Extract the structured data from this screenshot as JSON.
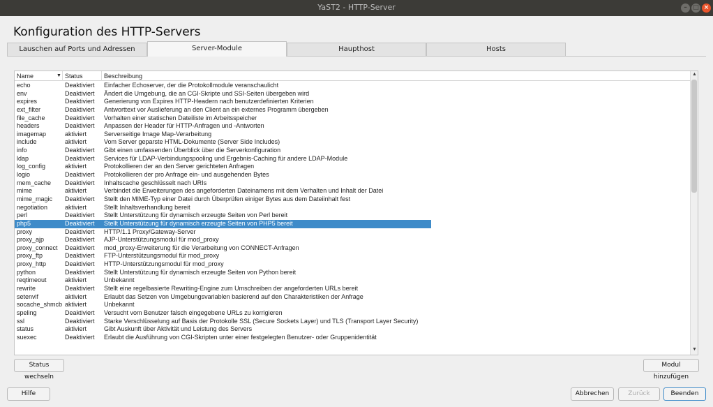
{
  "window": {
    "title": "YaST2 - HTTP-Server"
  },
  "page": {
    "title": "Konfiguration des HTTP-Servers"
  },
  "tabs": [
    {
      "label": "Lauschen auf Ports und Adressen",
      "active": false
    },
    {
      "label": "Server-Module",
      "active": true
    },
    {
      "label": "Haupthost",
      "active": false
    },
    {
      "label": "Hosts",
      "active": false
    }
  ],
  "table": {
    "columns": [
      "Name",
      "Status",
      "Beschreibung"
    ],
    "rows": [
      {
        "name": "echo",
        "status": "Deaktiviert",
        "desc": "Einfacher Echoserver, der die Protokollmodule veranschaulicht"
      },
      {
        "name": "env",
        "status": "Deaktiviert",
        "desc": "Ändert die Umgebung, die an CGI-Skripte und SSI-Seiten übergeben wird"
      },
      {
        "name": "expires",
        "status": "Deaktiviert",
        "desc": "Generierung von Expires HTTP-Headern nach benutzerdefinierten Kriterien"
      },
      {
        "name": "ext_filter",
        "status": "Deaktiviert",
        "desc": "Antworttext vor Auslieferung an den Client an ein externes Programm übergeben"
      },
      {
        "name": "file_cache",
        "status": "Deaktiviert",
        "desc": "Vorhalten einer statischen Dateiliste im Arbeitsspeicher"
      },
      {
        "name": "headers",
        "status": "Deaktiviert",
        "desc": "Anpassen der Header für HTTP-Anfragen und -Antworten"
      },
      {
        "name": "imagemap",
        "status": "aktiviert",
        "desc": "Serverseitige Image Map-Verarbeitung"
      },
      {
        "name": "include",
        "status": "aktiviert",
        "desc": "Vom Server geparste HTML-Dokumente (Server Side Includes)"
      },
      {
        "name": "info",
        "status": "Deaktiviert",
        "desc": "Gibt einen umfassenden Überblick über die Serverkonfiguration"
      },
      {
        "name": "ldap",
        "status": "Deaktiviert",
        "desc": "Services für LDAP-Verbindungspooling und Ergebnis-Caching für andere LDAP-Module"
      },
      {
        "name": "log_config",
        "status": "aktiviert",
        "desc": "Protokollieren der an den Server gerichteten Anfragen"
      },
      {
        "name": "logio",
        "status": "Deaktiviert",
        "desc": "Protokollieren der pro Anfrage ein- und ausgehenden Bytes"
      },
      {
        "name": "mem_cache",
        "status": "Deaktiviert",
        "desc": "Inhaltscache geschlüsselt nach URIs"
      },
      {
        "name": "mime",
        "status": "aktiviert",
        "desc": "Verbindet die Erweiterungen des angeforderten Dateinamens mit dem Verhalten und Inhalt der Datei"
      },
      {
        "name": "mime_magic",
        "status": "Deaktiviert",
        "desc": "Stellt den MIME-Typ einer Datei durch Überprüfen einiger Bytes aus dem Dateiinhalt fest"
      },
      {
        "name": "negotiation",
        "status": "aktiviert",
        "desc": "Stellt Inhaltsverhandlung bereit"
      },
      {
        "name": "perl",
        "status": "Deaktiviert",
        "desc": "Stellt Unterstützung für dynamisch erzeugte Seiten von Perl bereit"
      },
      {
        "name": "php5",
        "status": "Deaktiviert",
        "desc": "Stellt Unterstützung für dynamisch erzeugte Seiten von PHP5 bereit",
        "selected": true
      },
      {
        "name": "proxy",
        "status": "Deaktiviert",
        "desc": "HTTP/1.1 Proxy/Gateway-Server"
      },
      {
        "name": "proxy_ajp",
        "status": "Deaktiviert",
        "desc": "AJP-Unterstützungsmodul für mod_proxy"
      },
      {
        "name": "proxy_connect",
        "status": "Deaktiviert",
        "desc": "mod_proxy-Erweiterung für die Verarbeitung von CONNECT-Anfragen"
      },
      {
        "name": "proxy_ftp",
        "status": "Deaktiviert",
        "desc": "FTP-Unterstützungsmodul für mod_proxy"
      },
      {
        "name": "proxy_http",
        "status": "Deaktiviert",
        "desc": "HTTP-Unterstützungsmodul für mod_proxy"
      },
      {
        "name": "python",
        "status": "Deaktiviert",
        "desc": "Stellt Unterstützung für dynamisch erzeugte Seiten von Python bereit"
      },
      {
        "name": "reqtimeout",
        "status": "aktiviert",
        "desc": "Unbekannt"
      },
      {
        "name": "rewrite",
        "status": "Deaktiviert",
        "desc": "Stellt eine regelbasierte Rewriting-Engine zum Umschreiben der angeforderten URLs bereit"
      },
      {
        "name": "setenvif",
        "status": "aktiviert",
        "desc": "Erlaubt das Setzen von Umgebungsvariablen basierend auf den Charakteristiken der Anfrage"
      },
      {
        "name": "socache_shmcb",
        "status": "aktiviert",
        "desc": "Unbekannt"
      },
      {
        "name": "speling",
        "status": "Deaktiviert",
        "desc": "Versucht vom Benutzer falsch eingegebene URLs zu korrigieren"
      },
      {
        "name": "ssl",
        "status": "Deaktiviert",
        "desc": "Starke Verschlüsselung auf Basis der Protokolle SSL (Secure Sockets Layer) und TLS (Transport Layer Security)"
      },
      {
        "name": "status",
        "status": "aktiviert",
        "desc": "Gibt Auskunft über Aktivität und Leistung des Servers"
      },
      {
        "name": "suexec",
        "status": "Deaktiviert",
        "desc": "Erlaubt die Ausführung von CGI-Skripten unter einer festgelegten Benutzer- oder Gruppenidentität"
      }
    ]
  },
  "buttons": {
    "toggle_status": "Status wechseln",
    "add_module": "Modul hinzufügen",
    "help": "Hilfe",
    "cancel": "Abbrechen",
    "back": "Zurück",
    "finish": "Beenden"
  },
  "colors": {
    "selection": "#3e8bc9",
    "titlebar": "#3c3b37",
    "close": "#e9542b"
  }
}
